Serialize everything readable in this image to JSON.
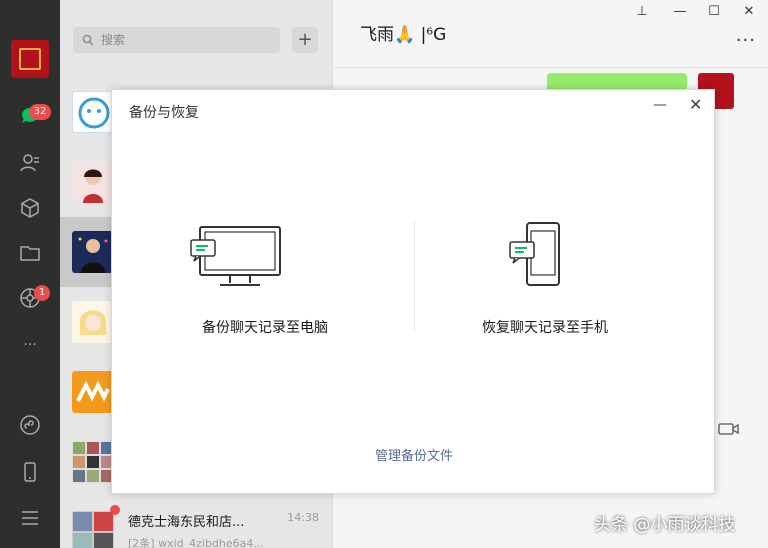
{
  "nav": {
    "chat_badge": "32",
    "moments_badge": "1",
    "more_label": "···"
  },
  "search": {
    "placeholder": "搜索",
    "add_label": "+"
  },
  "chat_list": {
    "items": [
      {
        "name": "",
        "time": "",
        "preview": ""
      },
      {
        "name": "",
        "time": "",
        "preview": ""
      },
      {
        "name": "",
        "time": "",
        "preview": ""
      },
      {
        "name": "",
        "time": "",
        "preview": ""
      },
      {
        "name": "",
        "time": "",
        "preview": ""
      },
      {
        "name": "",
        "time": "",
        "preview": ""
      },
      {
        "name": "德克士海东民和店...",
        "time": "14:38",
        "preview": "[2条] wxid_4zibdhe6a4..."
      }
    ]
  },
  "chat": {
    "title": "飞雨🙏 |⁶G",
    "more_label": "···",
    "window_controls": {
      "pin": "⊥",
      "min": "—",
      "max": "☐",
      "close": "✕"
    }
  },
  "dialog": {
    "title": "备份与恢复",
    "min_label": "—",
    "close_label": "✕",
    "backup_label": "备份聊天记录至电脑",
    "restore_label": "恢复聊天记录至手机",
    "manage_label": "管理备份文件"
  },
  "watermark": "头条 @小雨谈科技",
  "colors": {
    "nav_bg": "#2e2e2e",
    "list_bg": "#e6e6e6",
    "accent_green": "#95ec69",
    "link_blue": "#576b95",
    "badge_red": "#f04b4b"
  }
}
